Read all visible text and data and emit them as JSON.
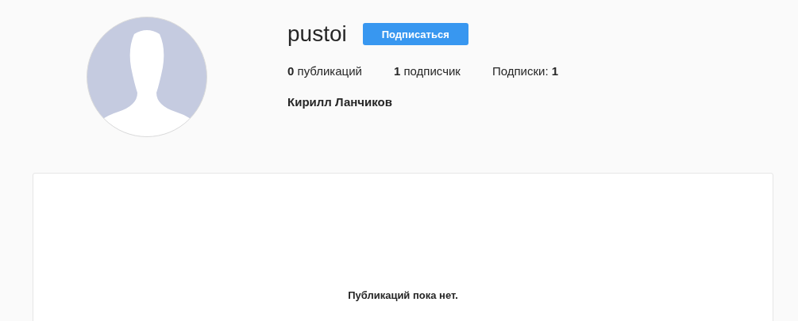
{
  "profile": {
    "username": "pustoi",
    "follow_button": "Подписаться",
    "stats": [
      "**0** публикаций",
      "**1** подписчик",
      "Подписки: **1**"
    ],
    "full_name": "Кирилл Ланчиков"
  },
  "posts": {
    "empty_message": "Публикаций пока нет."
  }
}
